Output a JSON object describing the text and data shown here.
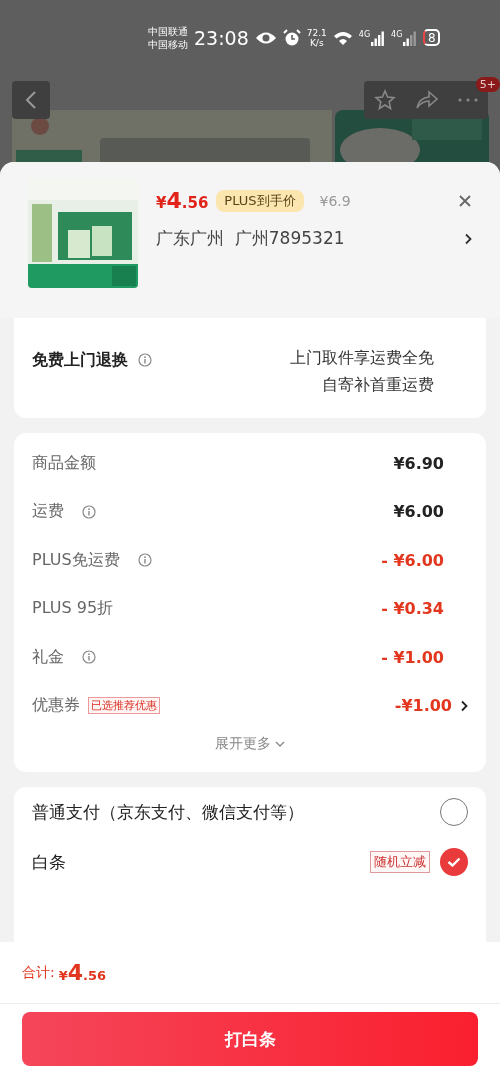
{
  "status_bar": {
    "carriers": [
      "中国联通",
      "中国移动"
    ],
    "time": "23:08",
    "speed": [
      "72.1",
      "K/s"
    ],
    "networks": [
      "4G",
      "4G"
    ],
    "battery": "8"
  },
  "nav": {
    "badge": "5+"
  },
  "product": {
    "currency": "¥",
    "price_main": "4",
    "price_cents": ".56",
    "plus_tag": "PLUS到手价",
    "original_price": "¥6.9",
    "address": "广东广州  广州7895321"
  },
  "return_service": {
    "label": "免费上门退换",
    "lines": [
      "上门取件享运费全免",
      "自寄补首重运费"
    ]
  },
  "costs": [
    {
      "label": "商品金额",
      "info": false,
      "value": "¥6.90",
      "color": "#222222",
      "chevron": false
    },
    {
      "label": "运费",
      "info": true,
      "value": "¥6.00",
      "color": "#222222",
      "chevron": false
    },
    {
      "label": "PLUS免运费",
      "info": true,
      "value": "- ¥6.00",
      "color": "#e2361e",
      "chevron": false
    },
    {
      "label": "PLUS 95折",
      "info": false,
      "value": "- ¥0.34",
      "color": "#e2361e",
      "chevron": false
    },
    {
      "label": "礼金",
      "info": true,
      "value": "- ¥1.00",
      "color": "#e2361e",
      "chevron": false
    },
    {
      "label": "优惠券",
      "info": false,
      "tag": "已选推荐优惠",
      "value": "-¥1.00",
      "color": "#e2361e",
      "chevron": true
    }
  ],
  "expand": "展开更多",
  "payment_options": [
    {
      "label": "普通支付（京东支付、微信支付等）",
      "selected": false
    },
    {
      "label": "白条",
      "tag": "随机立减",
      "selected": true
    }
  ],
  "total": {
    "label": "合计:",
    "currency": "¥",
    "main": "4",
    "cents": ".56"
  },
  "submit": "打白条"
}
